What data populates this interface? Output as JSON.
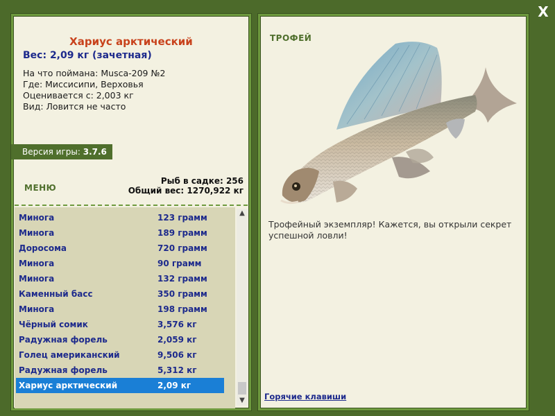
{
  "catch": {
    "title": "Хариус арктический",
    "weight_line": "Вес: 2,09 кг (зачетная)",
    "details": [
      "На что поймана: Musca-209 №2",
      "Где: Миссисипи, Верховья",
      "Оценивается с: 2,003 кг",
      "Вид: Ловится не часто"
    ]
  },
  "version": {
    "label": "Версия игры:",
    "value": "3.7.6"
  },
  "menu_label": "МЕНЮ",
  "stats": {
    "fish_in_keepnet": "Рыб в садке: 256",
    "total_weight": "Общий вес: 1270,922 кг"
  },
  "fish_list": [
    {
      "name": "Минога",
      "weight": "123 грамм"
    },
    {
      "name": "Минога",
      "weight": "189 грамм"
    },
    {
      "name": "Доросома",
      "weight": "720 грамм"
    },
    {
      "name": "Минога",
      "weight": "90 грамм"
    },
    {
      "name": "Минога",
      "weight": "132 грамм"
    },
    {
      "name": "Каменный басс",
      "weight": "350 грамм"
    },
    {
      "name": "Минога",
      "weight": "198 грамм"
    },
    {
      "name": "Чёрный сомик",
      "weight": "3,576 кг"
    },
    {
      "name": "Радужная форель",
      "weight": "2,059 кг"
    },
    {
      "name": "Голец американский",
      "weight": "9,506 кг"
    },
    {
      "name": "Радужная форель",
      "weight": "5,312 кг"
    },
    {
      "name": "Хариус арктический",
      "weight": "2,09 кг"
    }
  ],
  "selected_index": 11,
  "trophy": {
    "label": "ТРОФЕЙ",
    "text": "Трофейный экземпляр! Кажется, вы открыли секрет успешной ловли!"
  },
  "hotkeys_link": "Горячие клавиши",
  "close_label": "X",
  "colors": {
    "background": "#4c6a2a",
    "panel": "#f3f1e1",
    "accent_green": "#4f6f2c",
    "title_red": "#c8421c",
    "text_blue": "#1d2a8c",
    "selection_blue": "#1a7fd6"
  }
}
